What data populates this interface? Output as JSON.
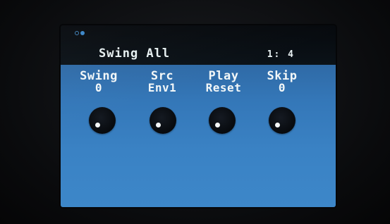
{
  "header": {
    "title": "Swing All",
    "page": "1: 4"
  },
  "params": [
    {
      "label": "Swing",
      "value": "0",
      "knob_level": 0.0
    },
    {
      "label": "Src",
      "value": "Env1",
      "knob_level": 0.0
    },
    {
      "label": "Play",
      "value": "Reset",
      "knob_level": 0.0
    },
    {
      "label": "Skip",
      "value": "0",
      "knob_level": 0.0
    }
  ],
  "colors": {
    "panel": "#3a82c4",
    "text": "#f2f7f8",
    "knob": "#070a0e",
    "status_indicator": "#3b86c8"
  },
  "icons": {
    "status": "status-dots-icon",
    "knob": "knob-icon"
  }
}
